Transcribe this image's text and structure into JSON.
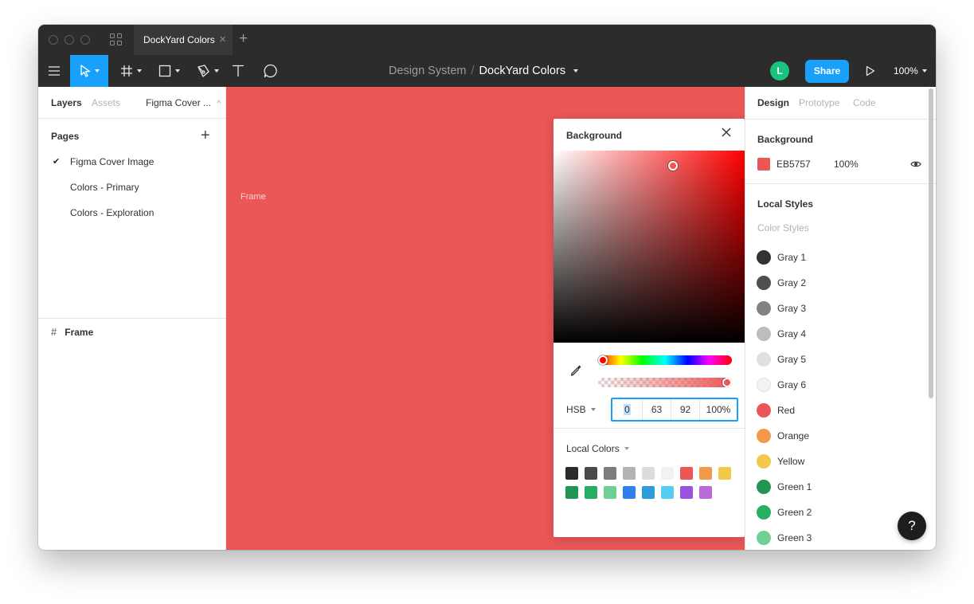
{
  "tab": {
    "title": "DockYard Colors"
  },
  "breadcrumb": {
    "project": "Design System",
    "separator": "/",
    "file": "DockYard Colors"
  },
  "user": {
    "avatar_initial": "L",
    "avatar_color": "#1bc47d"
  },
  "toolbar": {
    "share_label": "Share",
    "zoom": "100%"
  },
  "left_panel": {
    "tabs": [
      "Layers",
      "Assets"
    ],
    "page_selector": "Figma Cover ...",
    "pages_heading": "Pages",
    "pages": [
      {
        "label": "Figma Cover Image",
        "selected": true
      },
      {
        "label": "Colors - Primary",
        "selected": false
      },
      {
        "label": "Colors - Exploration",
        "selected": false
      }
    ],
    "layer": "Frame"
  },
  "canvas": {
    "frame_label": "Frame",
    "background": "#eb5757"
  },
  "picker": {
    "title": "Background",
    "mode": "HSB",
    "hue": "0",
    "saturation": "63",
    "brightness": "92",
    "opacity": "100%",
    "local_colors_label": "Local Colors",
    "swatches": [
      "#2b2b2b",
      "#4a4a4a",
      "#7d7d7d",
      "#b3b3b3",
      "#dcdcdc",
      "#f2f2f2",
      "#eb5757",
      "#f2994a",
      "#f2c94c",
      "#219653",
      "#27ae60",
      "#6fcf97",
      "#2f80ed",
      "#2d9cdb",
      "#56ccf2",
      "#9b51e0",
      "#bb6bd9"
    ]
  },
  "right_panel": {
    "tabs": [
      "Design",
      "Prototype",
      "Code"
    ],
    "background_heading": "Background",
    "background_hex": "EB5757",
    "background_opacity": "100%",
    "background_color": "#eb5757",
    "local_styles_heading": "Local Styles",
    "color_styles_label": "Color Styles",
    "styles": [
      {
        "name": "Gray 1",
        "color": "#333333"
      },
      {
        "name": "Gray 2",
        "color": "#4f4f4f"
      },
      {
        "name": "Gray 3",
        "color": "#828282"
      },
      {
        "name": "Gray 4",
        "color": "#bdbdbd"
      },
      {
        "name": "Gray 5",
        "color": "#e0e0e0"
      },
      {
        "name": "Gray 6",
        "color": "#f2f2f2"
      },
      {
        "name": "Red",
        "color": "#eb5757"
      },
      {
        "name": "Orange",
        "color": "#f2994a"
      },
      {
        "name": "Yellow",
        "color": "#f2c94c"
      },
      {
        "name": "Green 1",
        "color": "#219653"
      },
      {
        "name": "Green 2",
        "color": "#27ae60"
      },
      {
        "name": "Green 3",
        "color": "#6fcf97"
      }
    ],
    "help_label": "?"
  }
}
